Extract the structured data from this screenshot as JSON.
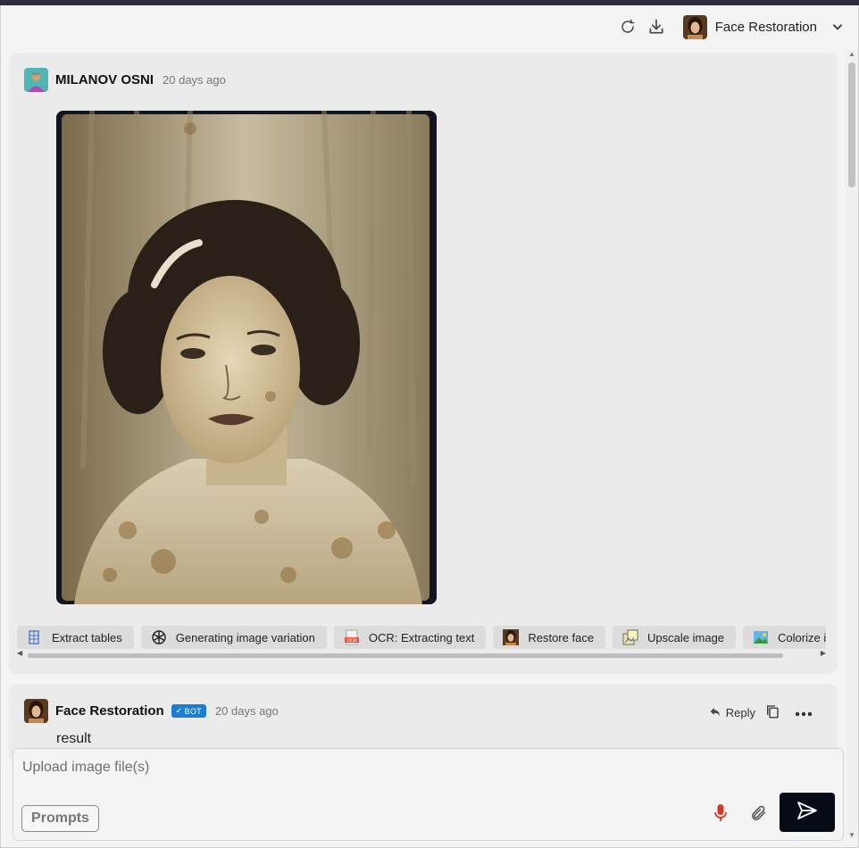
{
  "header": {
    "bot_name": "Face Restoration",
    "icons": [
      "refresh-icon",
      "download-icon",
      "chevron-down-icon"
    ]
  },
  "messages": [
    {
      "author": "MILANOV OSNI",
      "time": "20 days ago",
      "image_alt": "vintage portrait photo of a woman"
    },
    {
      "author": "Face Restoration",
      "badge": "BOT",
      "time": "20 days ago",
      "text": "result",
      "reply_label": "Reply"
    }
  ],
  "actions": [
    {
      "label": "Extract tables",
      "icon": "table-icon"
    },
    {
      "label": "Generating image variation",
      "icon": "openai-icon"
    },
    {
      "label": "OCR: Extracting text",
      "icon": "ocr-icon"
    },
    {
      "label": "Restore face",
      "icon": "face-icon"
    },
    {
      "label": "Upscale image",
      "icon": "upscale-icon"
    },
    {
      "label": "Colorize i",
      "icon": "landscape-icon"
    }
  ],
  "composer": {
    "placeholder": "Upload image file(s)",
    "prompts_label": "Prompts"
  },
  "colors": {
    "send_button": "#060b16",
    "bot_badge": "#1a7fd4",
    "mic": "#d03a2a"
  }
}
